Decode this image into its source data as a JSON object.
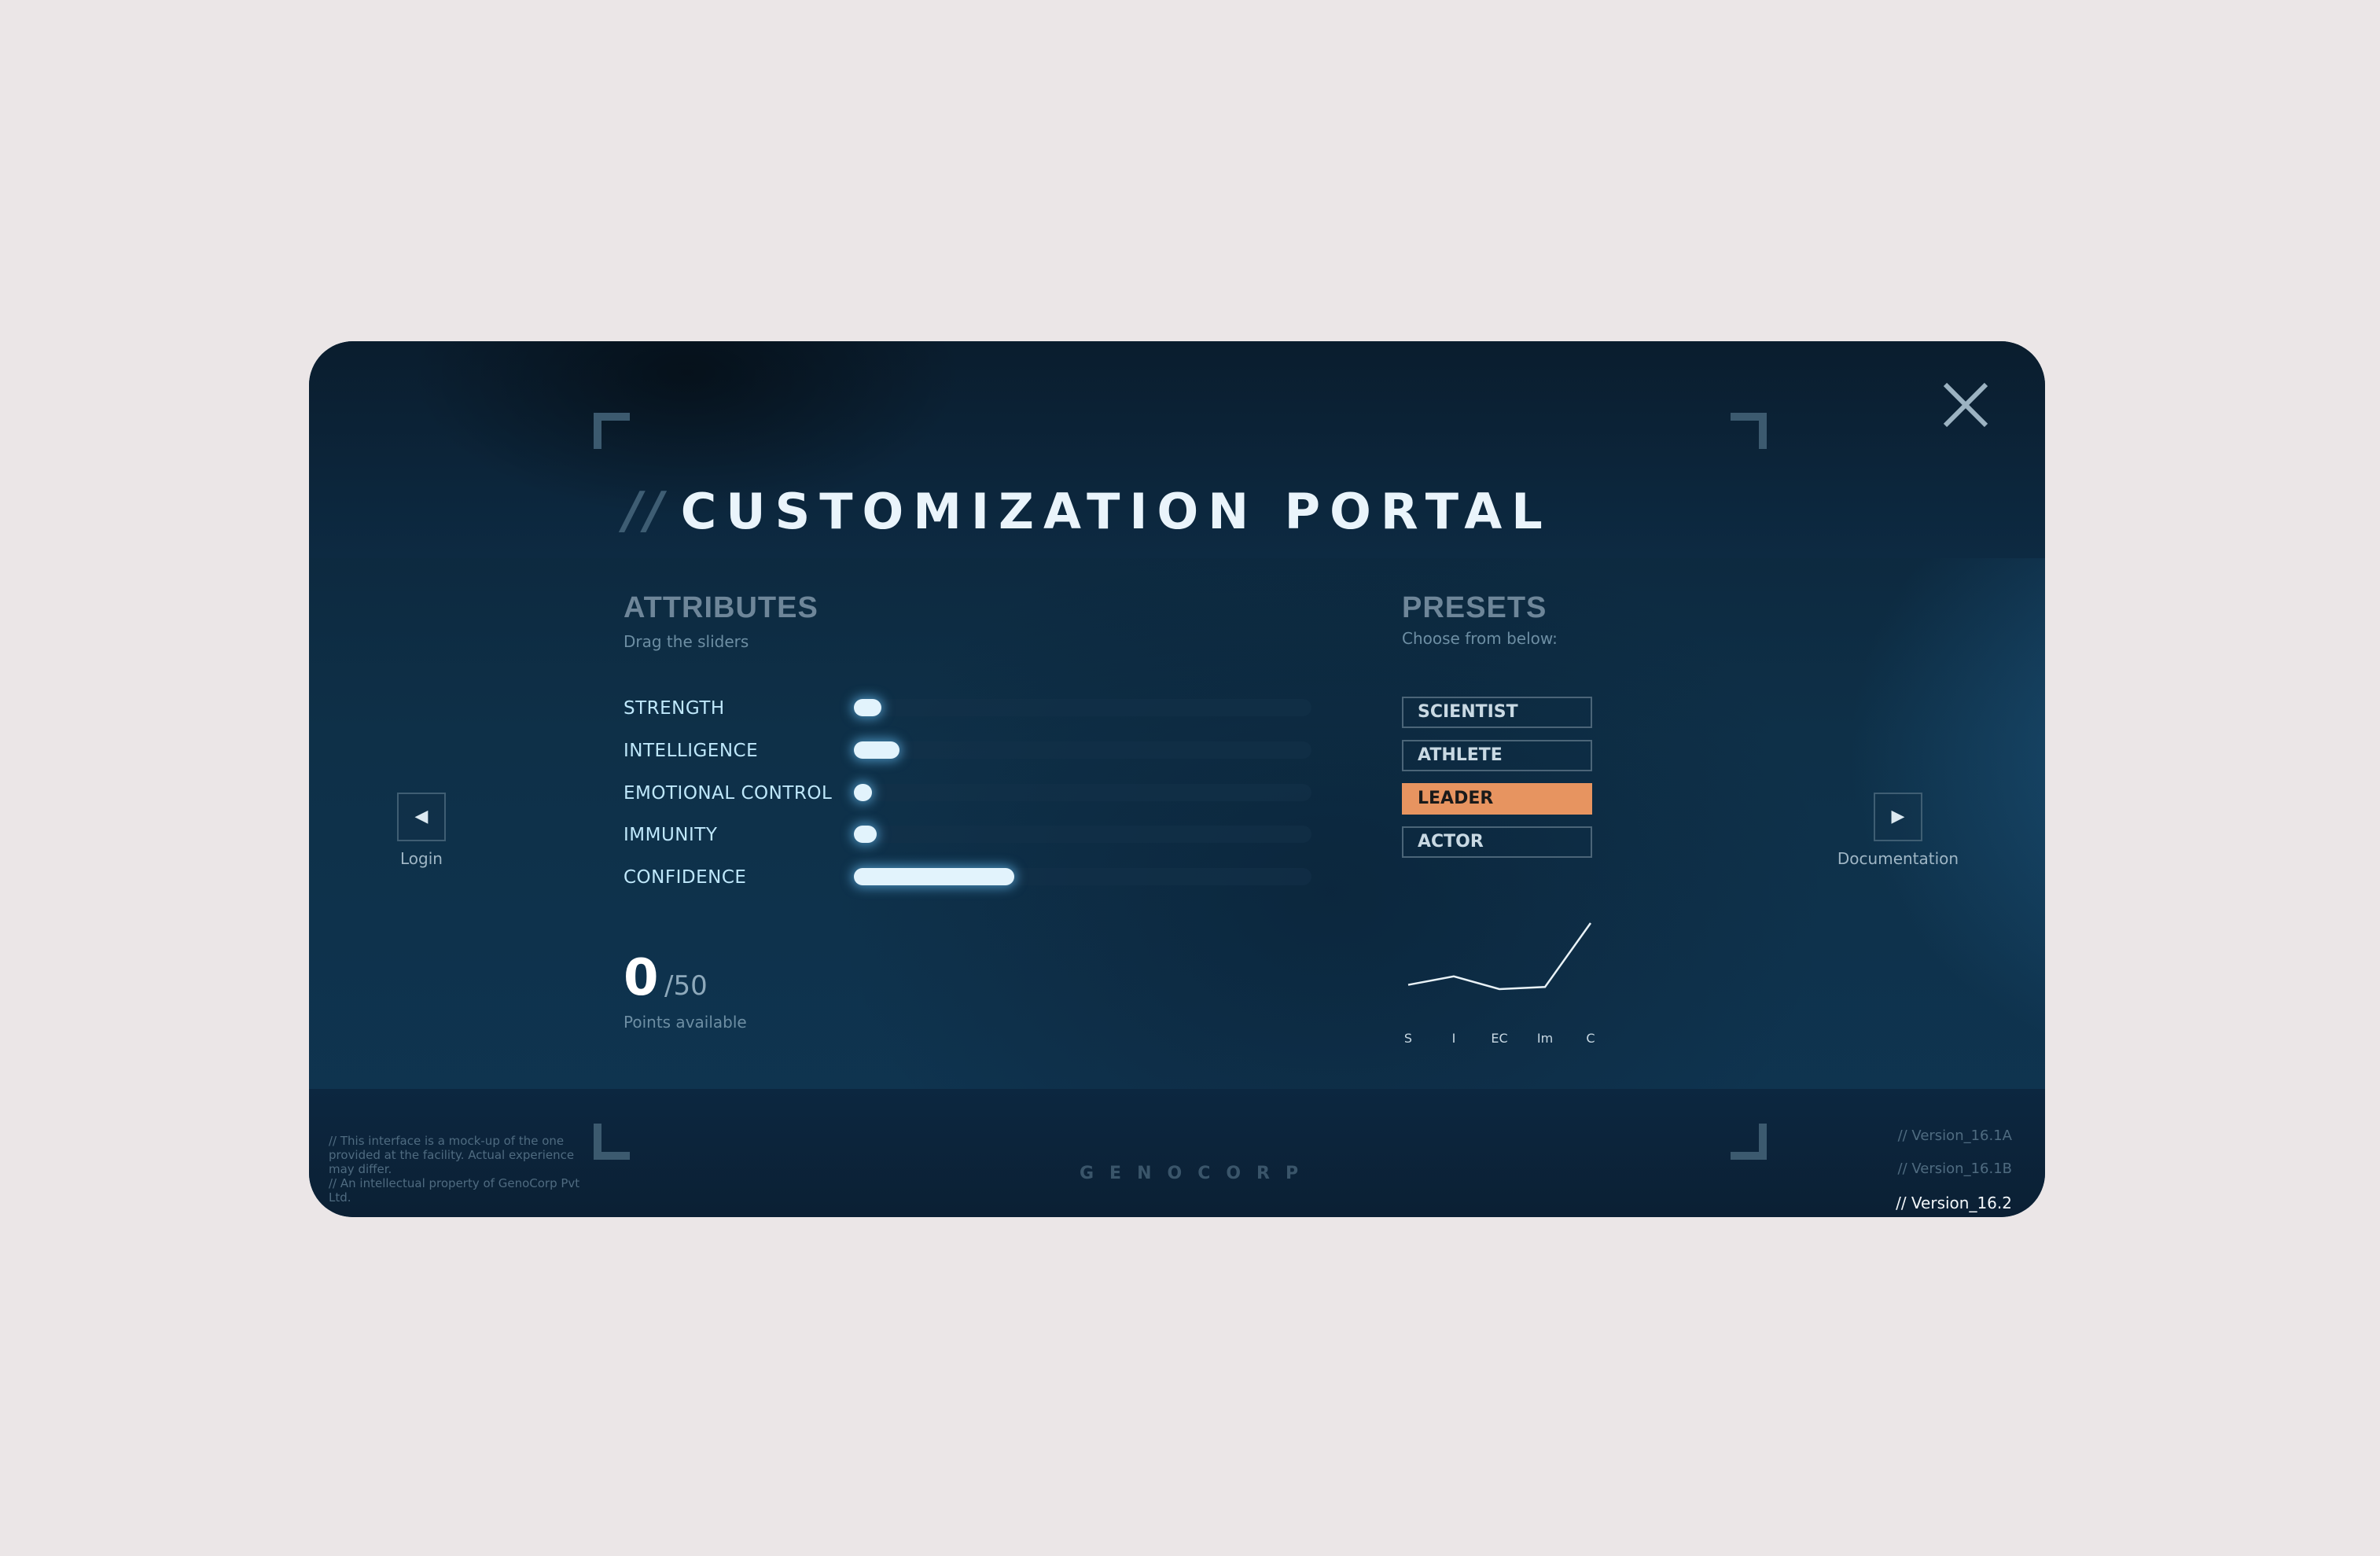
{
  "header": {
    "title_prefix": "//",
    "title": "CUSTOMIZATION PORTAL"
  },
  "attributes": {
    "heading": "ATTRIBUTES",
    "subheading": "Drag the sliders",
    "items": [
      {
        "label": "STRENGTH",
        "level": 0.06
      },
      {
        "label": "INTELLIGENCE",
        "level": 0.1
      },
      {
        "label": "EMOTIONAL CONTROL",
        "level": 0.04
      },
      {
        "label": "IMMUNITY",
        "level": 0.05
      },
      {
        "label": "CONFIDENCE",
        "level": 0.35
      }
    ]
  },
  "points": {
    "available": "0",
    "max": "/50",
    "label": "Points available"
  },
  "presets": {
    "heading": "PRESETS",
    "subheading": "Choose from below:",
    "items": [
      "SCIENTIST",
      "ATHLETE",
      "LEADER",
      "ACTOR"
    ],
    "selected": "LEADER"
  },
  "mini_chart": {
    "labels": [
      "S",
      "I",
      "EC",
      "Im",
      "C"
    ],
    "values": [
      0.06,
      0.1,
      0.04,
      0.05,
      0.35
    ]
  },
  "nav": {
    "prev_label": "Login",
    "next_label": "Documentation",
    "prev_icon": "◀",
    "next_icon": "▶"
  },
  "footer": {
    "note": "// This interface is a mock-up of the one provided at the facility. Actual experience may differ.\n// An intellectual property of GenoCorp Pvt Ltd.",
    "brand": "GENOCORP",
    "versions": [
      "// Version_16.1A",
      "// Version_16.1B",
      "// Version_16.2"
    ],
    "current_version": "// Version_16.2"
  },
  "colors": {
    "accent": "#e79460",
    "glow": "#e2f3fc",
    "panel": "#0e3048"
  }
}
